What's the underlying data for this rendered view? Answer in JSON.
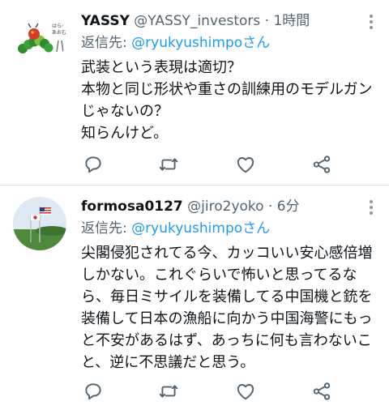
{
  "tweets": [
    {
      "name": "YASSY",
      "handle": "@YASSY_investors · 1時間",
      "reply_label": "返信先: ",
      "reply_to": "@ryukyushimpoさん",
      "text": "武装という表現は適切？\n本物と同じ形状や重さの訓練用のモデルガンじゃないの？\n知らんけど。",
      "avatar_text": "はらぺこあおむし"
    },
    {
      "name": "formosa0127",
      "handle": "@jiro2yoko · 6分",
      "reply_label": "返信先: ",
      "reply_to": "@ryukyushimpoさん",
      "text": "尖閣侵犯されてる今、カッコいい安心感倍増しかない。これぐらいで怖いと思ってるなら、毎日ミサイルを装備してる中国機と銃を装備して日本の漁船に向かう中国海警にもっと不安があるはず、あっちに何も言わないこと、逆に不思議だと思う。"
    }
  ],
  "icons": {
    "reply": "reply-icon",
    "retweet": "retweet-icon",
    "like": "heart-icon",
    "share": "share-icon",
    "more": "more-vertical-icon"
  },
  "colors": {
    "accent": "#1d9bf0",
    "muted": "#536471",
    "icon": "#536471",
    "divider": "#e1e8ed"
  }
}
